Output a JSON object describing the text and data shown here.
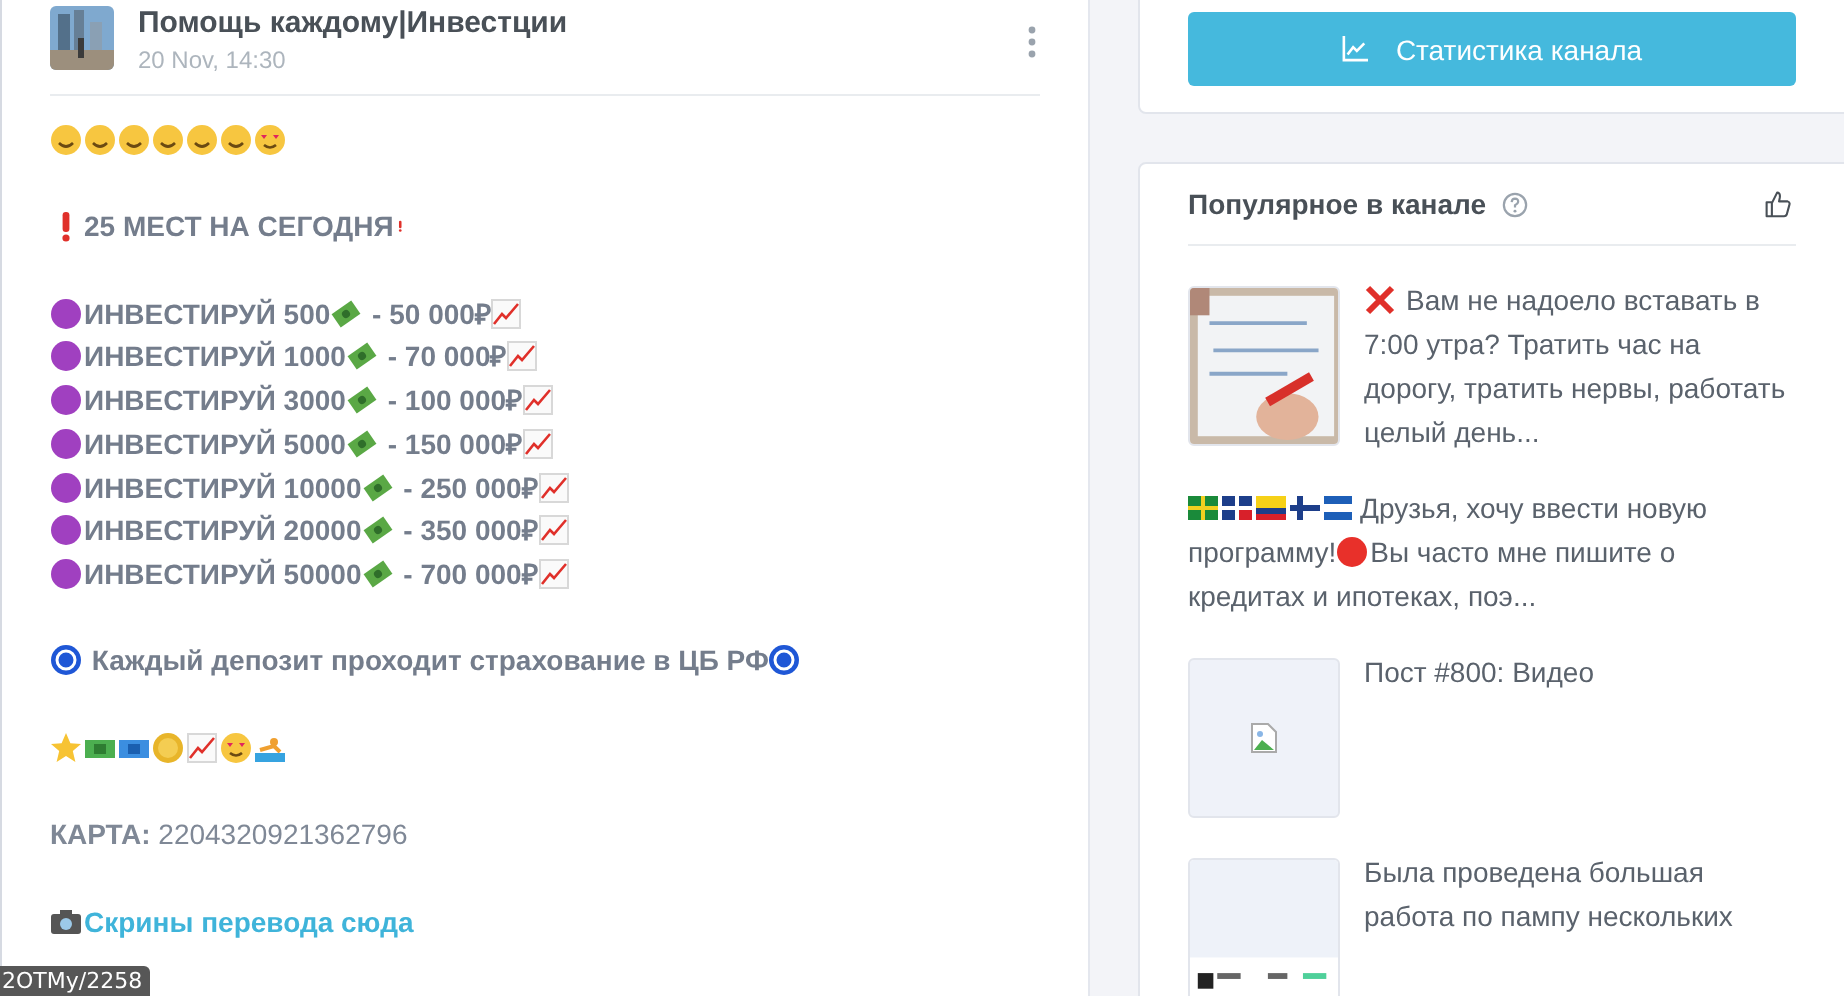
{
  "post": {
    "channel": "Помощь каждому|Инвестции",
    "date": "20 Nov, 14:30",
    "headline": "25 МЕСТ НА СЕГОДНЯ",
    "offers": [
      {
        "invest": "ИНВЕСТИРУЙ 500",
        "result": " - 50 000₽"
      },
      {
        "invest": "ИНВЕСТИРУЙ 1000",
        "result": " - 70 000₽"
      },
      {
        "invest": "ИНВЕСТИРУЙ 3000",
        "result": " - 100 000₽"
      },
      {
        "invest": "ИНВЕСТИРУЙ 5000",
        "result": " - 150 000₽"
      },
      {
        "invest": "ИНВЕСТИРУЙ 10000",
        "result": " - 250 000₽"
      },
      {
        "invest": "ИНВЕСТИРУЙ 20000",
        "result": " - 350 000₽"
      },
      {
        "invest": "ИНВЕСТИРУЙ 50000",
        "result": " - 700 000₽"
      }
    ],
    "notice": "Каждый депозит проходит страхование в ЦБ РФ",
    "card": "**КАРТА:** 2204320921362796",
    "link": "Скрины перевода сюда"
  },
  "sidebar": {
    "stats_button": "Статистика канала",
    "popular": {
      "title": "Популярное в канале",
      "posts": [
        {
          "kind": "picture",
          "text": "Вам не надоело вставать в 7:00 утра? Тратить час на дорогу, тратить нервы, работать целый день..."
        },
        {
          "kind": "text",
          "text": "Друзья, хочу ввести новую программу!",
          "text_2": "Вы часто мне пишите о кредитах и ипотеках, поэ..."
        },
        {
          "kind": "broken-image",
          "text": "Пост #800: Видео"
        },
        {
          "kind": "picture",
          "text": "Была проведена большая работа по пампу нескольких"
        }
      ]
    }
  },
  "tooltip": "2OTMy/2258"
}
